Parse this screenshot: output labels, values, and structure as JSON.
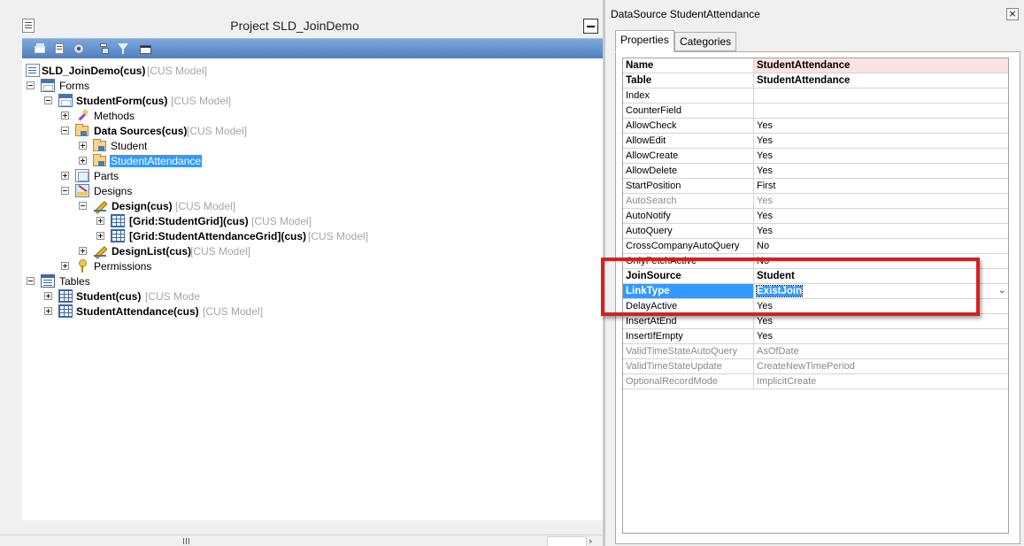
{
  "project": {
    "title": "Project SLD_JoinDemo",
    "toolbar_icons": [
      "open-icon",
      "save-icon",
      "compile-icon",
      "import-icon",
      "filter-icon",
      "film-icon"
    ]
  },
  "tree": {
    "root": {
      "label": "SLD_JoinDemo(cus)",
      "model": "[CUS Model]"
    },
    "forms": "Forms",
    "studentform": {
      "label": "StudentForm(cus)",
      "model": "[CUS Model]"
    },
    "methods": "Methods",
    "datasources": {
      "label": "Data Sources(cus)",
      "model": "[CUS Model]"
    },
    "ds_student": "Student",
    "ds_attendance": "StudentAttendance",
    "parts": "Parts",
    "designs": "Designs",
    "design": {
      "label": "Design(cus)",
      "model": "[CUS Model]"
    },
    "grid_student": {
      "label": "[Grid:StudentGrid](cus)",
      "model": "[CUS Model]"
    },
    "grid_attendance": {
      "label": "[Grid:StudentAttendanceGrid](cus)",
      "model": "[CUS Model]"
    },
    "designlist": {
      "label": "DesignList(cus)",
      "model": "[CUS Model]"
    },
    "permissions": "Permissions",
    "tables": "Tables",
    "tbl_student": {
      "label": "Student(cus)",
      "model": "[CUS Mode"
    },
    "tbl_attendance": {
      "label": "StudentAttendance(cus)",
      "model": "[CUS Model]"
    }
  },
  "hscroll": {
    "grip": "III"
  },
  "properties": {
    "title": "DataSource StudentAttendance",
    "tabs": [
      "Properties",
      "Categories"
    ],
    "rows": [
      {
        "name": "Name",
        "value": "StudentAttendance"
      },
      {
        "name": "Table",
        "value": "StudentAttendance"
      },
      {
        "name": "Index",
        "value": ""
      },
      {
        "name": "CounterField",
        "value": ""
      },
      {
        "name": "AllowCheck",
        "value": "Yes"
      },
      {
        "name": "AllowEdit",
        "value": "Yes"
      },
      {
        "name": "AllowCreate",
        "value": "Yes"
      },
      {
        "name": "AllowDelete",
        "value": "Yes"
      },
      {
        "name": "StartPosition",
        "value": "First"
      },
      {
        "name": "AutoSearch",
        "value": "Yes"
      },
      {
        "name": "AutoNotify",
        "value": "Yes"
      },
      {
        "name": "AutoQuery",
        "value": "Yes"
      },
      {
        "name": "CrossCompanyAutoQuery",
        "value": "No"
      },
      {
        "name": "OnlyFetchActive",
        "value": "No"
      },
      {
        "name": "JoinSource",
        "value": "Student"
      },
      {
        "name": "LinkType",
        "value": "ExistJoin"
      },
      {
        "name": "DelayActive",
        "value": "Yes"
      },
      {
        "name": "InsertAtEnd",
        "value": "Yes"
      },
      {
        "name": "InsertIfEmpty",
        "value": "Yes"
      },
      {
        "name": "ValidTimeStateAutoQuery",
        "value": "AsOfDate"
      },
      {
        "name": "ValidTimeStateUpdate",
        "value": "CreateNewTimePeriod"
      },
      {
        "name": "OptionalRecordMode",
        "value": "ImplicitCreate"
      }
    ]
  },
  "colors": {
    "highlight_box": "#d81f1f",
    "selection": "#3399ff",
    "toolbar": "#5f8ecb"
  }
}
